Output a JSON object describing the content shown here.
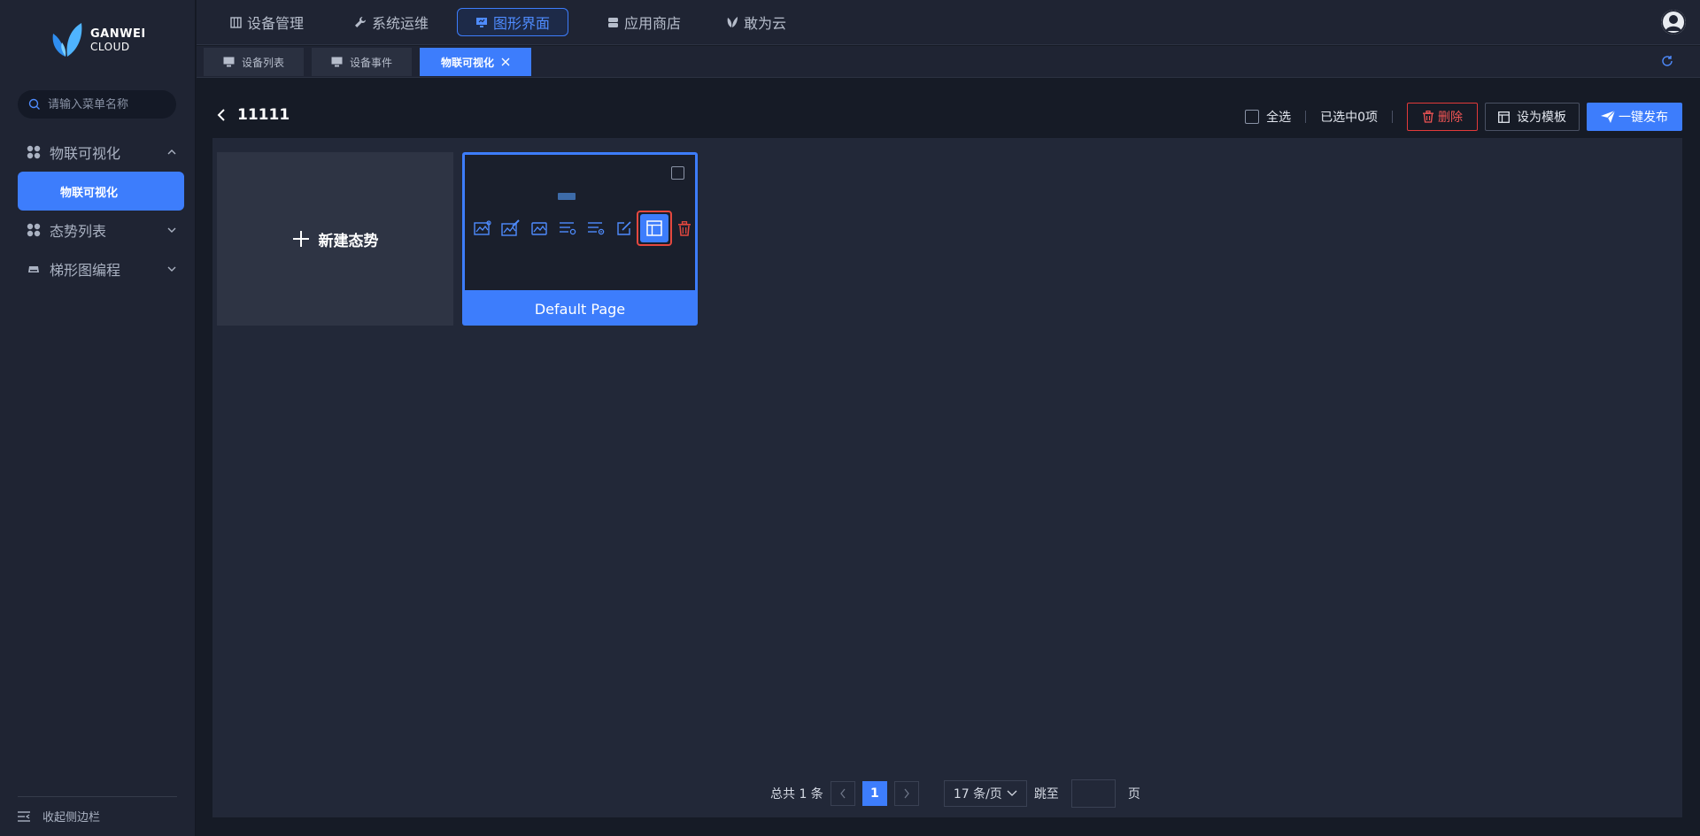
{
  "brand": {
    "line1": "GANWEI",
    "line2": "CLOUD"
  },
  "sidebar": {
    "search_placeholder": "请输入菜单名称",
    "groups": [
      {
        "label": "物联可视化",
        "expanded": true,
        "children": [
          "物联可视化"
        ]
      },
      {
        "label": "态势列表",
        "expanded": false
      },
      {
        "label": "梯形图编程",
        "expanded": false
      }
    ],
    "collapse_label": "收起侧边栏"
  },
  "topnav": {
    "tabs": [
      {
        "label": "设备管理",
        "icon": "device-icon"
      },
      {
        "label": "系统运维",
        "icon": "wrench-icon"
      },
      {
        "label": "图形界面",
        "icon": "monitor-icon",
        "active": true
      },
      {
        "label": "应用商店",
        "icon": "store-icon"
      },
      {
        "label": "敢为云",
        "icon": "cloud-icon"
      }
    ]
  },
  "pagetabs": [
    {
      "label": "设备列表",
      "icon": "monitor-icon"
    },
    {
      "label": "设备事件",
      "icon": "monitor-icon"
    },
    {
      "label": "物联可视化",
      "active": true,
      "closable": true
    }
  ],
  "content": {
    "title": "11111",
    "toolbar": {
      "select_all": "全选",
      "selected_count": "已选中0项",
      "delete": "删除",
      "set_template": "设为模板",
      "publish": "一键发布"
    },
    "new_card_label": "新建态势",
    "pages": [
      {
        "label": "Default Page"
      }
    ]
  },
  "pagination": {
    "total": "总共 1 条",
    "current": "1",
    "page_size": "17 条/页",
    "jump_label": "跳至",
    "page_suffix": "页"
  },
  "colors": {
    "accent": "#3d7dfc",
    "danger": "#e23a3a",
    "bg": "#161b26",
    "sidebar": "#1f2433"
  }
}
